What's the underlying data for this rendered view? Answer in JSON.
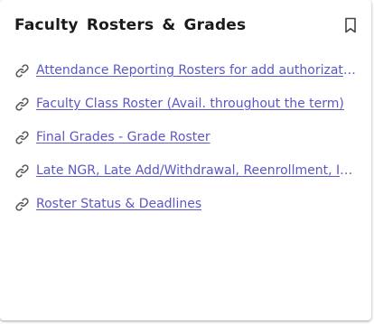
{
  "card": {
    "title": "Faculty Rosters & Grades",
    "bookmark_icon": "bookmark-icon",
    "link_icon": "link-icon",
    "colors": {
      "link": "#5b57c4",
      "title": "#1a1a1a",
      "icon": "#555555"
    },
    "links": [
      {
        "label": "Attendance Reporting Rosters for add authorizations"
      },
      {
        "label": "Faculty Class Roster (Avail. throughout the term)"
      },
      {
        "label": "Final Grades - Grade Roster"
      },
      {
        "label": "Late NGR, Late Add/Withdrawal, Reenrollment, Incomplete"
      },
      {
        "label": "Roster Status & Deadlines"
      }
    ]
  }
}
